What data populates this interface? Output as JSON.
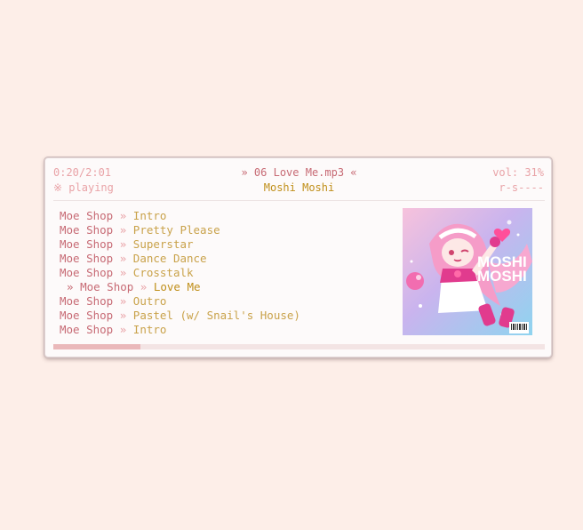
{
  "player": {
    "time": "0:20/2:01",
    "status_glyph": "※",
    "status_text": "playing",
    "now_playing": "» 06 Love Me.mp3 «",
    "album": "Moshi Moshi",
    "volume": "vol: 31%",
    "mode_flags": "r-s----",
    "progress_fraction": 0.177
  },
  "playlist": [
    {
      "artist": "Moe Shop",
      "sep": " » ",
      "title": "Intro",
      "current": false
    },
    {
      "artist": "Moe Shop",
      "sep": " » ",
      "title": "Pretty Please",
      "current": false
    },
    {
      "artist": "Moe Shop",
      "sep": " » ",
      "title": "Superstar",
      "current": false
    },
    {
      "artist": "Moe Shop",
      "sep": " » ",
      "title": "Dance Dance",
      "current": false
    },
    {
      "artist": "Moe Shop",
      "sep": " » ",
      "title": "Crosstalk",
      "current": false
    },
    {
      "prefix": "» ",
      "artist": "Moe Shop",
      "sep": " » ",
      "title": "Love Me",
      "current": true
    },
    {
      "artist": "Moe Shop",
      "sep": " » ",
      "title": "Outro",
      "current": false
    },
    {
      "artist": "Moe Shop",
      "sep": " » ",
      "title": "Pastel (w/ Snail's House)",
      "current": false
    },
    {
      "artist": "Moe Shop",
      "sep": " » ",
      "title": "Intro",
      "current": false
    }
  ],
  "cover_art": {
    "text_line1": "MOSHI",
    "text_line2": "MOSHI"
  },
  "colors": {
    "background": "#fdeee8",
    "accent_pink": "#e9a3a7",
    "accent_rose": "#c76a74",
    "accent_gold": "#c9a24a"
  }
}
